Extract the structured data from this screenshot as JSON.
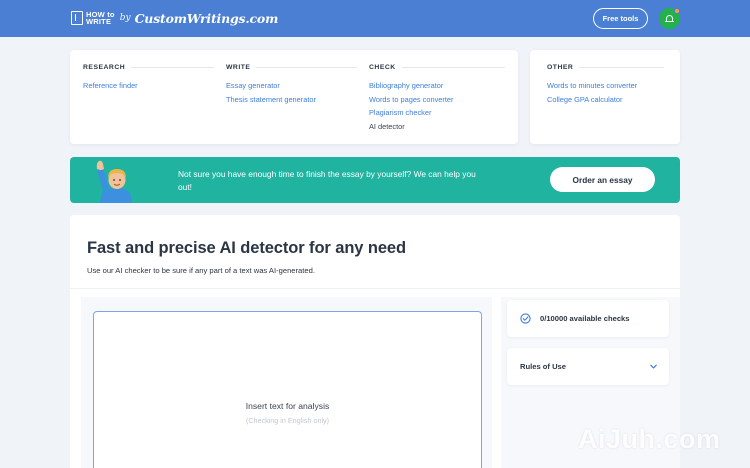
{
  "header": {
    "logo": {
      "how_line1": "HOW to",
      "how_line2": "WRITE",
      "by": "by",
      "brand": "CustomWritings.com"
    },
    "free_tools_label": "Free tools",
    "accent_color": "#4a7fd4",
    "notification_color": "#21b24a"
  },
  "menu": {
    "columns": [
      {
        "title": "RESEARCH",
        "links": [
          "Reference finder"
        ]
      },
      {
        "title": "WRITE",
        "links": [
          "Essay generator",
          "Thesis statement generator"
        ]
      },
      {
        "title": "CHECK",
        "links": [
          "Bibliography generator",
          "Words to pages converter",
          "Plagiarism checker",
          "AI detector"
        ]
      }
    ],
    "other": {
      "title": "OTHER",
      "links": [
        "Words to minutes converter",
        "College GPA calculator"
      ]
    }
  },
  "banner": {
    "text": "Not sure you have enough time to finish the essay by yourself? We can help you out!",
    "button_label": "Order an essay",
    "background_color": "#1fb3a0"
  },
  "main": {
    "title": "Fast and precise AI detector for any need",
    "subtitle": "Use our AI checker to be sure if any part of a text was AI-generated.",
    "editor": {
      "placeholder": "Insert text for analysis",
      "note": "(Checking in English only)"
    },
    "sidebar": {
      "checks_label": "0/10000 available checks",
      "rules_label": "Rules of Use"
    }
  },
  "watermark": "AiJuh.com"
}
